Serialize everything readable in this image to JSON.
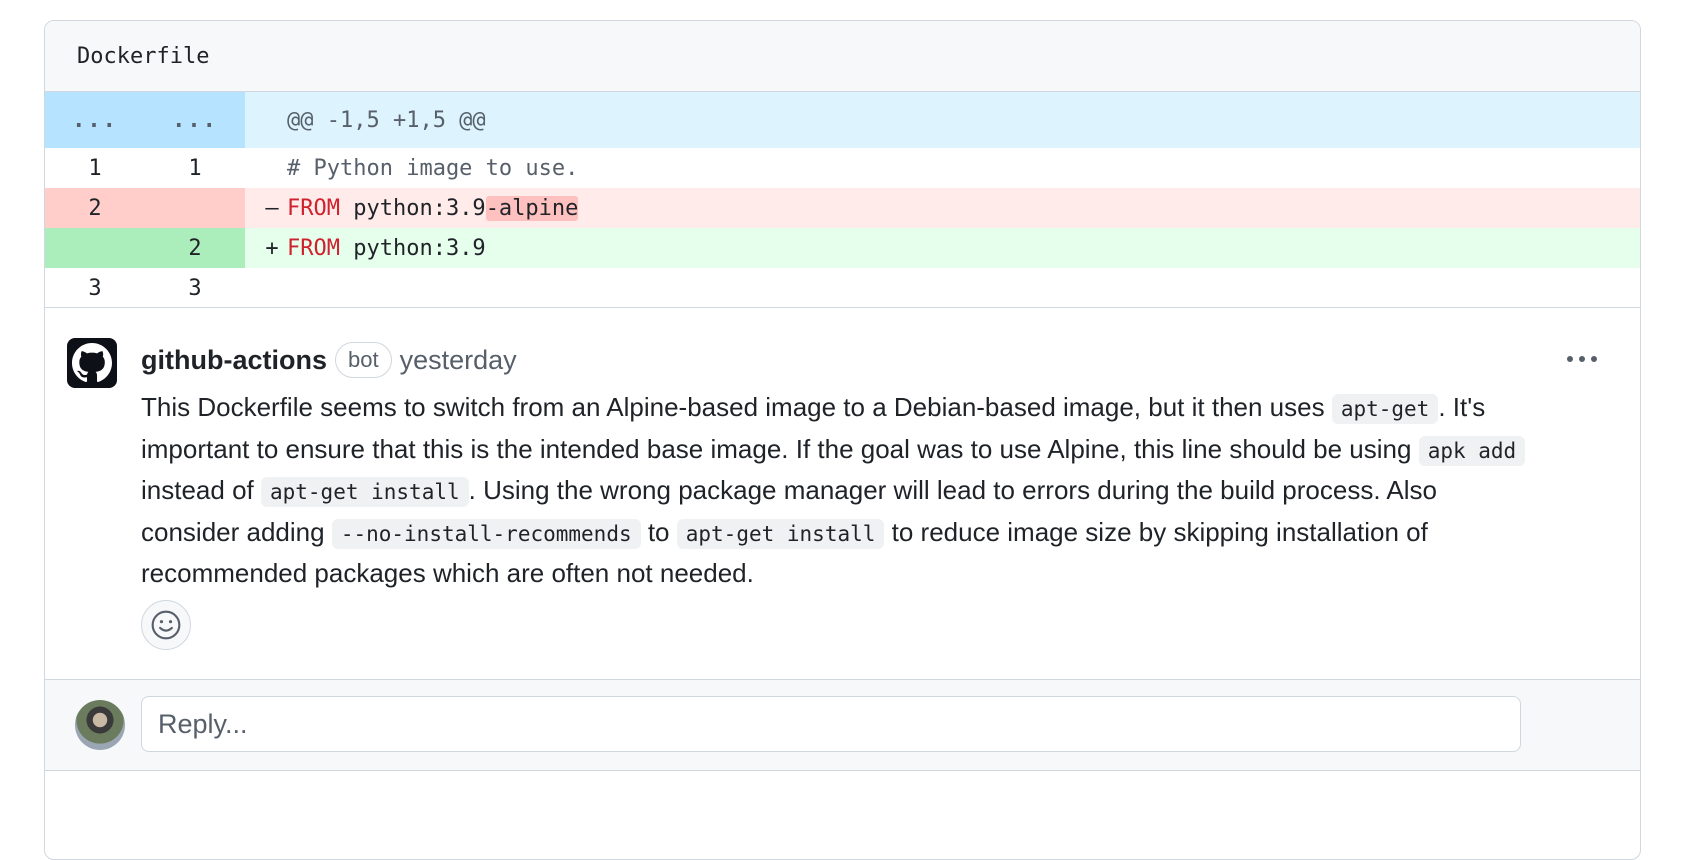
{
  "file": {
    "name": "Dockerfile"
  },
  "diff": {
    "hunk": {
      "old_marker": "...",
      "new_marker": "...",
      "text": "@@ -1,5 +1,5 @@"
    },
    "lines": [
      {
        "type": "ctx",
        "old": "1",
        "new": "1",
        "marker": "",
        "code": "# Python image to use."
      },
      {
        "type": "del",
        "old": "2",
        "new": "",
        "marker": "–",
        "kw": "FROM",
        "code": " python:3.9",
        "highlight": "-alpine"
      },
      {
        "type": "add",
        "old": "",
        "new": "2",
        "marker": "+",
        "kw": "FROM",
        "code": " python:3.9",
        "highlight": ""
      },
      {
        "type": "ctx",
        "old": "3",
        "new": "3",
        "marker": "",
        "code": ""
      }
    ]
  },
  "comment": {
    "author": "github-actions",
    "badge": "bot",
    "time": "yesterday",
    "body": [
      {
        "t": "This Dockerfile seems to switch from an Alpine-based image to a Debian-based image, but it then uses "
      },
      {
        "code": "apt-get"
      },
      {
        "t": ". It's important to ensure that this is the intended base image. If the goal was to use Alpine, this line should be using "
      },
      {
        "code": "apk add"
      },
      {
        "t": " instead of "
      },
      {
        "code": "apt-get install"
      },
      {
        "t": ". Using the wrong package manager will lead to errors during the build process. Also consider adding "
      },
      {
        "code": "--no-install-recommends"
      },
      {
        "t": " to "
      },
      {
        "code": "apt-get install"
      },
      {
        "t": " to reduce image size by skipping installation of recommended packages which are often not needed."
      }
    ]
  },
  "reply": {
    "placeholder": "Reply..."
  },
  "icons": {
    "bot_avatar": "github-mark-icon",
    "reaction": "smiley-icon",
    "menu": "kebab-horizontal-icon"
  }
}
